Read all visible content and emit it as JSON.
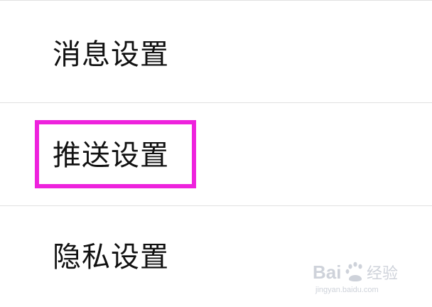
{
  "settings": {
    "items": [
      {
        "label": "消息设置"
      },
      {
        "label": "推送设置",
        "highlighted": true
      },
      {
        "label": "隐私设置"
      }
    ]
  },
  "colors": {
    "highlight": "#ee22dd",
    "divider": "#e1e1e1",
    "text": "#111111",
    "watermark": "#c9ced6"
  },
  "watermark": {
    "logo": "Baidu经验",
    "url": "jingyan.baidu.com"
  }
}
